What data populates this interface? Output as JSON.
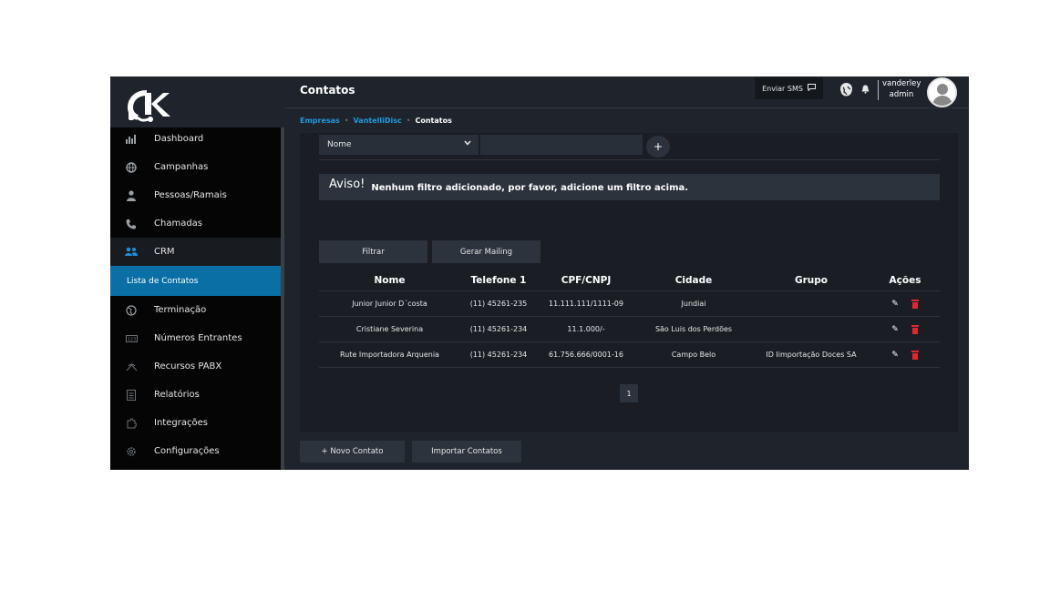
{
  "header": {
    "title": "Contatos",
    "sms_button": "Enviar SMS",
    "user_name": "vanderley",
    "user_role": "admin"
  },
  "breadcrumb": [
    "Empresas",
    "VantelliDisc",
    "Contatos"
  ],
  "sidebar": {
    "items": [
      {
        "label": "Dashboard",
        "icon": "bar-chart-icon"
      },
      {
        "label": "Campanhas",
        "icon": "globe-icon"
      },
      {
        "label": "Pessoas/Ramais",
        "icon": "person-icon"
      },
      {
        "label": "Chamadas",
        "icon": "phone-icon"
      },
      {
        "label": "CRM",
        "icon": "users-icon"
      },
      {
        "label": "Terminação",
        "icon": "globe-outline-icon"
      },
      {
        "label": "Números Entrantes",
        "icon": "number-icon"
      },
      {
        "label": "Recursos PABX",
        "icon": "antenna-icon"
      },
      {
        "label": "Relatórios",
        "icon": "report-icon"
      },
      {
        "label": "Integrações",
        "icon": "puzzle-icon"
      },
      {
        "label": "Configurações",
        "icon": "gear-icon"
      }
    ],
    "subitem": "Lista de Contatos"
  },
  "filter": {
    "field": "Nome",
    "value": ""
  },
  "alert": {
    "title": "Aviso!",
    "text": "Nenhum filtro adicionado, por favor, adicione um filtro acima."
  },
  "buttons": {
    "filtrar": "Filtrar",
    "gerar_mailing": "Gerar Mailing",
    "novo_contato": "+ Novo Contato",
    "importar_contatos": "Importar Contatos"
  },
  "table": {
    "headers": [
      "Nome",
      "Telefone 1",
      "CPF/CNPJ",
      "Cidade",
      "Grupo",
      "Ações"
    ],
    "rows": [
      {
        "nome": "Junior Junior D´costa",
        "telefone": "(11) 45261-235",
        "cpf": "11.111.111/1111-09",
        "cidade": "Jundiai",
        "grupo": ""
      },
      {
        "nome": "Cristiane Severina",
        "telefone": "(11) 45261-234",
        "cpf": "11.1.000/-",
        "cidade": "São Luis dos Perdões",
        "grupo": ""
      },
      {
        "nome": "Rute Importadora Arquenia",
        "telefone": "(11) 45261-234",
        "cpf": "61.756.666/0001-16",
        "cidade": "Campo Belo",
        "grupo": "ID Iimportação Doces SA"
      }
    ]
  },
  "pagination": {
    "current_page": "1"
  },
  "colors": {
    "accent": "#1d9be0",
    "active_item": "#0a6fa5",
    "delete": "#e3262e",
    "background": "#1f242c"
  }
}
